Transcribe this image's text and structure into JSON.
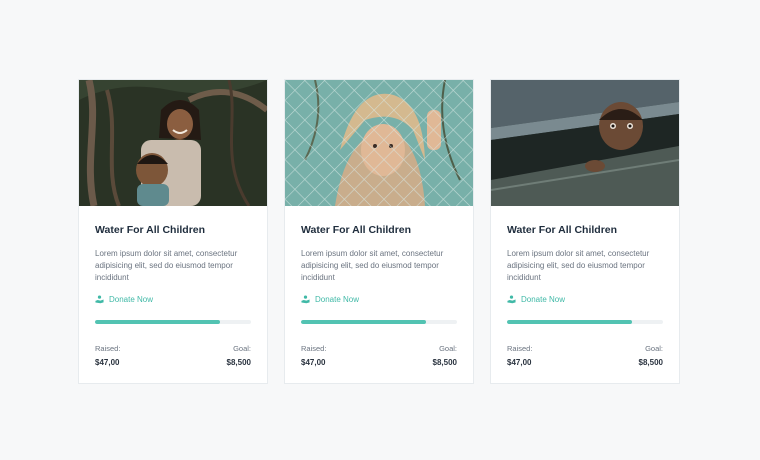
{
  "colors": {
    "accent": "#40b9a7",
    "progress_fill": "#52c3b2",
    "progress_track": "#eef1f3",
    "title": "#1f2d3d",
    "text": "#6b7480"
  },
  "cards": [
    {
      "title": "Water For All Children",
      "description": "Lorem ipsum dolor sit amet, consectetur adipisicing elit, sed do eiusmod tempor incididunt",
      "donate_label": "Donate Now",
      "donate_icon": "donate-hand-icon",
      "progress_percent": 80,
      "raised_label": "Raised:",
      "raised_value": "$47,00",
      "goal_label": "Goal:",
      "goal_value": "$8,500"
    },
    {
      "title": "Water For All Children",
      "description": "Lorem ipsum dolor sit amet, consectetur adipisicing elit, sed do eiusmod tempor incididunt",
      "donate_label": "Donate Now",
      "donate_icon": "donate-hand-icon",
      "progress_percent": 80,
      "raised_label": "Raised:",
      "raised_value": "$47,00",
      "goal_label": "Goal:",
      "goal_value": "$8,500"
    },
    {
      "title": "Water For All Children",
      "description": "Lorem ipsum dolor sit amet, consectetur adipisicing elit, sed do eiusmod tempor incididunt",
      "donate_label": "Donate Now",
      "donate_icon": "donate-hand-icon",
      "progress_percent": 80,
      "raised_label": "Raised:",
      "raised_value": "$47,00",
      "goal_label": "Goal:",
      "goal_value": "$8,500"
    }
  ]
}
